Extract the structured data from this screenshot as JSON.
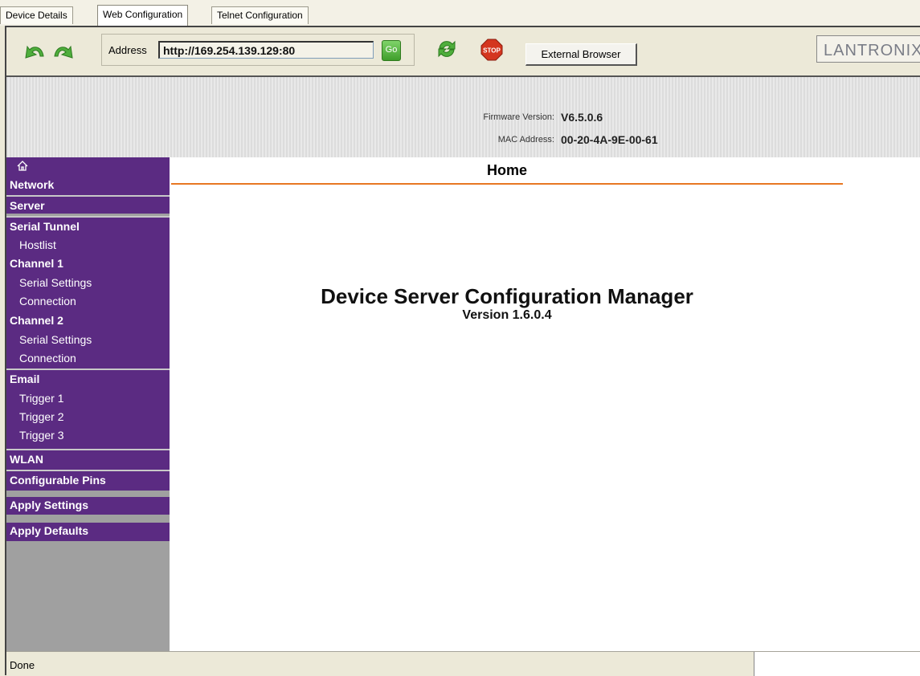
{
  "tabs": [
    {
      "label": "Device Details"
    },
    {
      "label": "Web Configuration"
    },
    {
      "label": "Telnet Configuration"
    }
  ],
  "toolbar": {
    "back_icon": "back-arrow-icon",
    "forward_icon": "forward-arrow-icon",
    "address_label": "Address",
    "address_value": "http://169.254.139.129:80",
    "go_label": "Go",
    "refresh_icon": "refresh-icon",
    "stop_label": "STOP",
    "external_browser_label": "External Browser",
    "logo_text": "LANTRONIX"
  },
  "header": {
    "firmware_label": "Firmware Version:",
    "firmware_value": "V6.5.0.6",
    "mac_label": "MAC Address:",
    "mac_value": "00-20-4A-9E-00-61"
  },
  "sidebar": {
    "home_icon": "home-icon",
    "items": [
      {
        "label": "Network"
      },
      {
        "label": "Server"
      },
      {
        "label": "Serial Tunnel"
      },
      {
        "label": "Hostlist"
      },
      {
        "label": "Channel 1"
      },
      {
        "label": "Serial Settings"
      },
      {
        "label": "Connection"
      },
      {
        "label": "Channel 2"
      },
      {
        "label": "Serial Settings"
      },
      {
        "label": "Connection"
      },
      {
        "label": "Email"
      },
      {
        "label": "Trigger 1"
      },
      {
        "label": "Trigger 2"
      },
      {
        "label": "Trigger 3"
      },
      {
        "label": "WLAN"
      },
      {
        "label": "Configurable Pins"
      },
      {
        "label": "Apply Settings"
      },
      {
        "label": "Apply Defaults"
      }
    ]
  },
  "main": {
    "title": "Home",
    "heading": "Device Server Configuration Manager",
    "version": "Version 1.6.0.4"
  },
  "status": {
    "text": "Done"
  },
  "colors": {
    "sidebar_purple": "#5b2b82",
    "title_rule_orange": "#e87722",
    "go_green": "#3f9e2b",
    "stop_red": "#d4361f"
  }
}
